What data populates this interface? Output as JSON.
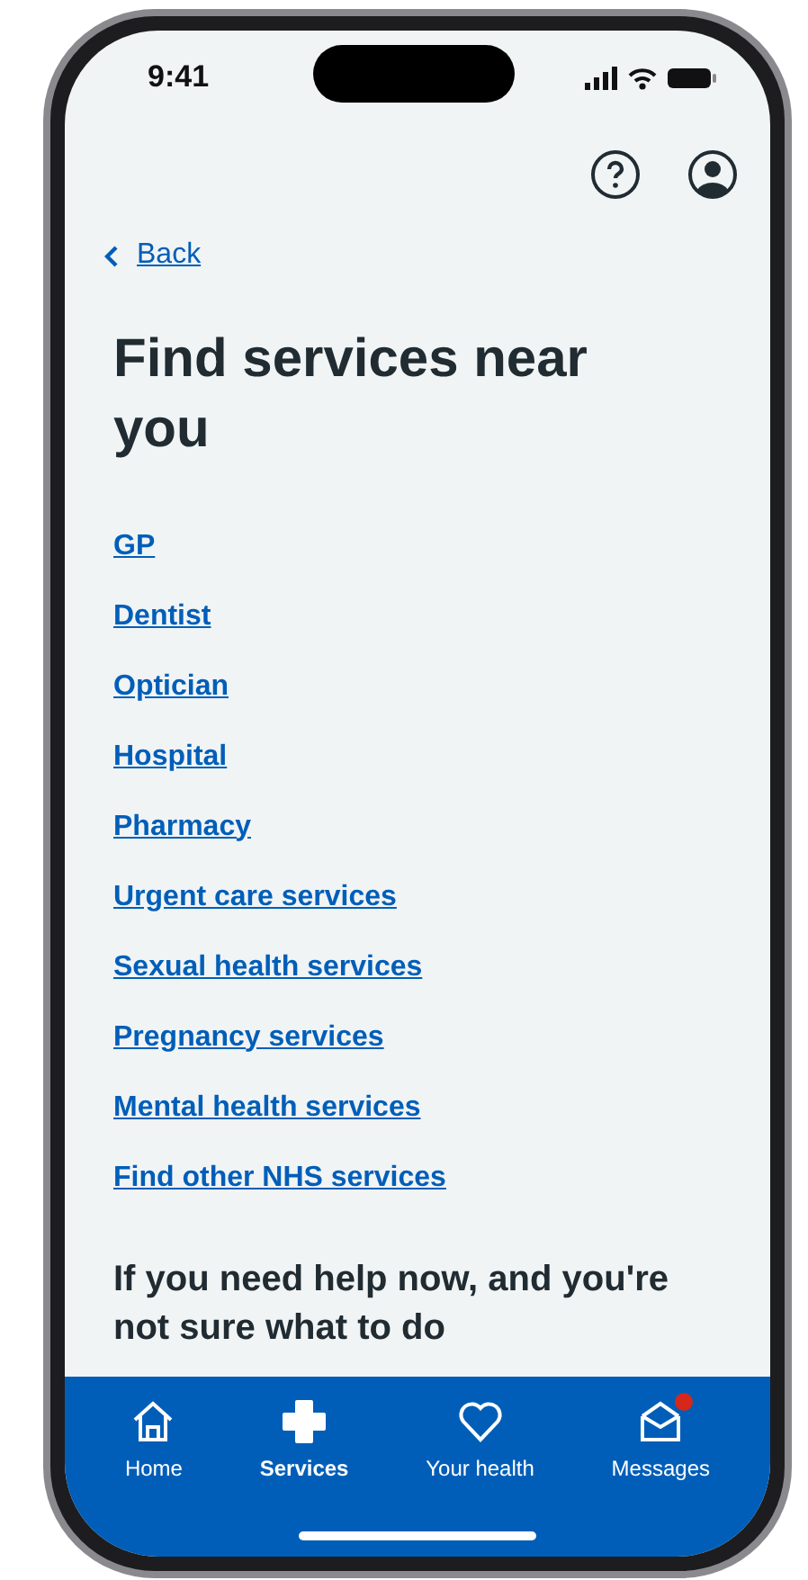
{
  "status_bar": {
    "time": "9:41"
  },
  "back_link": "Back",
  "title": "Find services near you",
  "services": [
    {
      "label": "GP"
    },
    {
      "label": "Dentist"
    },
    {
      "label": "Optician"
    },
    {
      "label": "Hospital"
    },
    {
      "label": "Pharmacy"
    },
    {
      "label": "Urgent care services"
    },
    {
      "label": "Sexual health services"
    },
    {
      "label": "Pregnancy services"
    },
    {
      "label": "Mental health services"
    },
    {
      "label": "Find other NHS services"
    }
  ],
  "help_heading": "If you need help now, and you're not sure what to do",
  "tab_bar": [
    {
      "kind": "home",
      "label": "Home",
      "selected": false,
      "notification": false
    },
    {
      "kind": "services",
      "label": "Services",
      "selected": true,
      "notification": false
    },
    {
      "kind": "health",
      "label": "Your health",
      "selected": false,
      "notification": false
    },
    {
      "kind": "messages",
      "label": "Messages",
      "selected": false,
      "notification": true
    }
  ]
}
